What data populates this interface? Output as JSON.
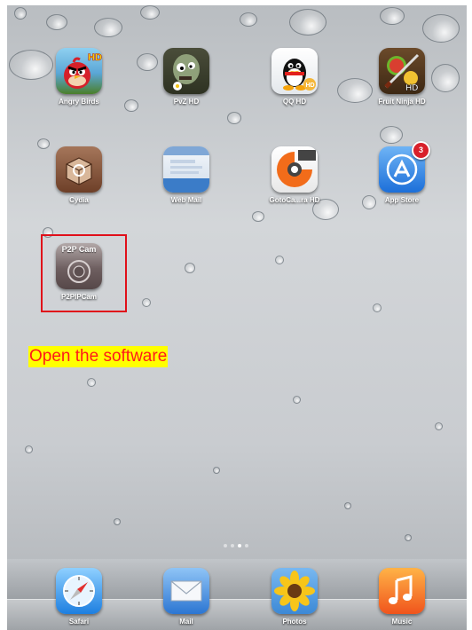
{
  "apps": [
    {
      "id": "angry-birds",
      "label": "Angry Birds",
      "icon": "angry-birds-icon"
    },
    {
      "id": "pvz-hd",
      "label": "PvZ HD",
      "icon": "zombie-icon"
    },
    {
      "id": "qq-hd",
      "label": "QQ HD",
      "icon": "penguin-icon"
    },
    {
      "id": "fruit-ninja-hd",
      "label": "Fruit Ninja HD",
      "icon": "fruit-ninja-icon"
    },
    {
      "id": "cydia",
      "label": "Cydia",
      "icon": "cydia-box-icon"
    },
    {
      "id": "web-mail",
      "label": "Web Mail",
      "icon": "web-mail-icon"
    },
    {
      "id": "gotocamera-hd",
      "label": "GotoCa...ra HD",
      "icon": "camera-logo-icon"
    },
    {
      "id": "app-store",
      "label": "App Store",
      "icon": "app-store-icon",
      "badge": "3"
    },
    {
      "id": "p2pipcam",
      "label": "P2PIPCam",
      "icon": "p2p-cam-icon",
      "icon_text": "P2P Cam"
    }
  ],
  "annotation": {
    "text": "Open the software"
  },
  "page_dots": {
    "count": 4,
    "active": 2
  },
  "dock": [
    {
      "id": "safari",
      "label": "Safari",
      "icon": "compass-icon"
    },
    {
      "id": "mail",
      "label": "Mail",
      "icon": "envelope-icon"
    },
    {
      "id": "photos",
      "label": "Photos",
      "icon": "sunflower-icon"
    },
    {
      "id": "music",
      "label": "Music",
      "icon": "music-note-icon"
    }
  ],
  "colors": {
    "highlight_border": "#e0101a",
    "annotation_bg": "#ffff00",
    "annotation_text": "#ff1a1a",
    "badge": "#d8202a"
  }
}
